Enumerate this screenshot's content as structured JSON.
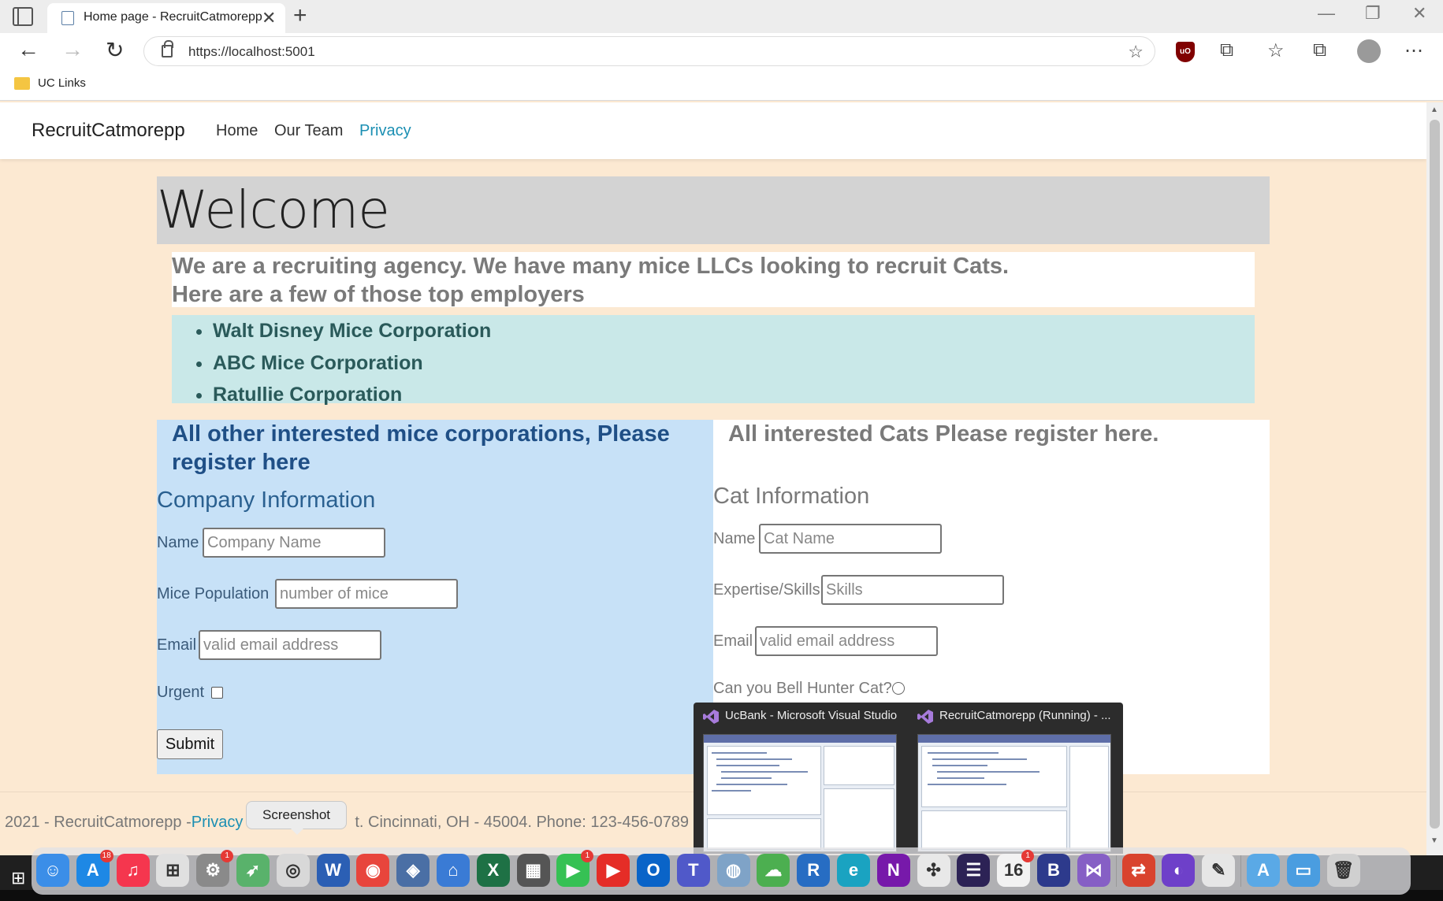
{
  "browser": {
    "tab_title": "Home page - RecruitCatmorepp",
    "tab_close": "✕",
    "new_tab": "+",
    "url": "https://localhost:5001",
    "bookmark_folder": "UC Links",
    "win_minimize": "—",
    "win_restore": "❐",
    "win_close": "✕",
    "back_glyph": "←",
    "forward_glyph": "→",
    "reload_glyph": "↻",
    "star_add_glyph": "☆",
    "ublock_text": "uO",
    "puzzle_glyph": "⧉",
    "favorites_glyph": "☆",
    "collections_glyph": "⧉",
    "more_glyph": "⋯"
  },
  "site": {
    "brand": "RecruitCatmorepp",
    "nav": [
      {
        "label": "Home"
      },
      {
        "label": "Our Team"
      },
      {
        "label": "Privacy"
      }
    ],
    "welcome": "Welcome",
    "intro_line1": "We are a recruiting agency. We have many mice LLCs looking to recruit Cats.",
    "intro_line2": "Here are a few of those top employers",
    "employers": [
      "Walt Disney Mice Corporation",
      "ABC Mice Corporation",
      "Ratullie Corporation"
    ]
  },
  "company_form": {
    "heading": "All other interested mice corporations, Please register here",
    "title": "Company Information",
    "name_label": "Name",
    "name_placeholder": "Company Name",
    "mice_label": "Mice Population",
    "mice_placeholder": "number of mice",
    "email_label": "Email",
    "email_placeholder": "valid email address",
    "urgent_label": "Urgent",
    "submit_label": "Submit"
  },
  "cat_form": {
    "heading": "All interested Cats Please register here.",
    "title": "Cat Information",
    "name_label": "Name",
    "name_placeholder": "Cat Name",
    "skills_label": "Expertise/Skills",
    "skills_placeholder": "Skills",
    "email_label": "Email",
    "email_placeholder": "valid email address",
    "bell_label": "Can you Bell Hunter Cat?"
  },
  "footer": {
    "prefix": "2021 - RecruitCatmorepp -",
    "privacy_link": "Privacy",
    "address": "t. Cincinnati, OH - 45004. Phone: 123-456-0789"
  },
  "tooltip": "Screenshot",
  "taskbar_popup": {
    "windows": [
      {
        "title": "UcBank - Microsoft Visual Studio"
      },
      {
        "title": "RecruitCatmorepp (Running) - ..."
      }
    ]
  },
  "dock": {
    "items": [
      {
        "name": "finder-icon",
        "color": "#3b8ee8",
        "glyph": "☺"
      },
      {
        "name": "app-store-icon",
        "color": "#1e88e5",
        "glyph": "A",
        "badge": "18"
      },
      {
        "name": "music-icon",
        "color": "#f5364e",
        "glyph": "♫"
      },
      {
        "name": "launchpad-icon",
        "color": "#e0e0e0",
        "glyph": "⊞"
      },
      {
        "name": "system-preferences-icon",
        "color": "#8a8a8a",
        "glyph": "⚙",
        "badge": "1"
      },
      {
        "name": "maps-icon",
        "color": "#59b26b",
        "glyph": "➶"
      },
      {
        "name": "screenshot-icon",
        "color": "#d8d8d8",
        "glyph": "◎"
      },
      {
        "name": "word-icon",
        "color": "#2b5fb4",
        "glyph": "W"
      },
      {
        "name": "chrome-icon",
        "color": "#e8453c",
        "glyph": "◉"
      },
      {
        "name": "vmware-icon",
        "color": "#4a6fa5",
        "glyph": "◈"
      },
      {
        "name": "home-icon",
        "color": "#3a7bd5",
        "glyph": "⌂"
      },
      {
        "name": "excel-icon",
        "color": "#1e7145",
        "glyph": "X"
      },
      {
        "name": "calculator-icon",
        "color": "#555555",
        "glyph": "▦"
      },
      {
        "name": "facetime-icon",
        "color": "#36c154",
        "glyph": "▶",
        "badge": "1"
      },
      {
        "name": "youtube-icon",
        "color": "#e52d27",
        "glyph": "▶"
      },
      {
        "name": "outlook-icon",
        "color": "#0a64c8",
        "glyph": "O"
      },
      {
        "name": "teams-icon",
        "color": "#5059c9",
        "glyph": "T"
      },
      {
        "name": "network-icon",
        "color": "#7fa3c7",
        "glyph": "◍"
      },
      {
        "name": "cloud-icon",
        "color": "#4caf50",
        "glyph": "☁"
      },
      {
        "name": "r-icon",
        "color": "#276dc3",
        "glyph": "R"
      },
      {
        "name": "edge-icon",
        "color": "#1aa3c1",
        "glyph": "e"
      },
      {
        "name": "onenote-icon",
        "color": "#7719aa",
        "glyph": "N"
      },
      {
        "name": "tableau-icon",
        "color": "#e8e8e8",
        "glyph": "✣"
      },
      {
        "name": "eclipse-icon",
        "color": "#2c2255",
        "glyph": "☰"
      },
      {
        "name": "calendar-icon",
        "color": "#f2f2f2",
        "glyph": "16",
        "badge": "1"
      },
      {
        "name": "bbedit-icon",
        "color": "#2d3a8c",
        "glyph": "B"
      },
      {
        "name": "visual-studio-icon",
        "color": "#865fc5",
        "glyph": "⋈"
      },
      {
        "name": "remote-desktop-icon",
        "color": "#d9432e",
        "glyph": "⇄"
      },
      {
        "name": "github-icon",
        "color": "#6e40c9",
        "glyph": "◐"
      },
      {
        "name": "textedit-icon",
        "color": "#e6e6e6",
        "glyph": "✎"
      },
      {
        "name": "applications-folder-icon",
        "color": "#5aa9e6",
        "glyph": "A"
      },
      {
        "name": "documents-folder-icon",
        "color": "#4a9de0",
        "glyph": "▭"
      },
      {
        "name": "trash-icon",
        "color": "#d0d0d0",
        "glyph": "🗑"
      }
    ]
  }
}
